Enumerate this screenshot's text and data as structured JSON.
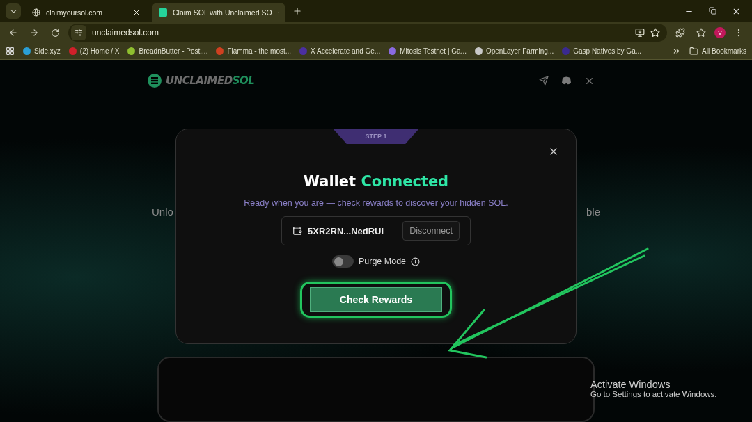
{
  "browser": {
    "tabs": [
      {
        "title": "claimyoursol.com",
        "selected": false
      },
      {
        "title": "Claim SOL with Unclaimed SO",
        "selected": true
      }
    ],
    "address": "unclaimedsol.com",
    "profile": "V",
    "bookmarks": [
      {
        "title": "Side.xyz",
        "color": "#2a9fd6"
      },
      {
        "title": "(2) Home / X",
        "color": "#d0202a"
      },
      {
        "title": "BreadnButter - Post,...",
        "color": "#8fbf2f"
      },
      {
        "title": "Fiamma - the most...",
        "color": "#d04020"
      },
      {
        "title": "X Accelerate and Ge...",
        "color": "#4b2fa0"
      },
      {
        "title": "Mitosis Testnet | Ga...",
        "color": "#8a6ae0"
      },
      {
        "title": "OpenLayer Farming...",
        "color": "#c8c8c8"
      },
      {
        "title": "Gasp Natives by Ga...",
        "color": "#3a2a90"
      }
    ],
    "all_bookmarks": "All Bookmarks"
  },
  "page": {
    "logo": {
      "first": "UNCLAIMED",
      "second": "SOL"
    },
    "background_text": [
      "Unlo",
      "ble"
    ],
    "modal": {
      "step": "STEP 1",
      "title": "Wallet",
      "title_accent": "Connected",
      "subtitle": "Ready when you are — check rewards to discover your hidden SOL.",
      "wallet_address": "5XR2RN...NedRUi",
      "disconnect": "Disconnect",
      "purge": {
        "label": "Purge Mode",
        "on": false
      },
      "button": "Check Rewards"
    }
  },
  "windows_notice": {
    "title": "Activate Windows",
    "subtitle": "Go to Settings to activate Windows."
  }
}
